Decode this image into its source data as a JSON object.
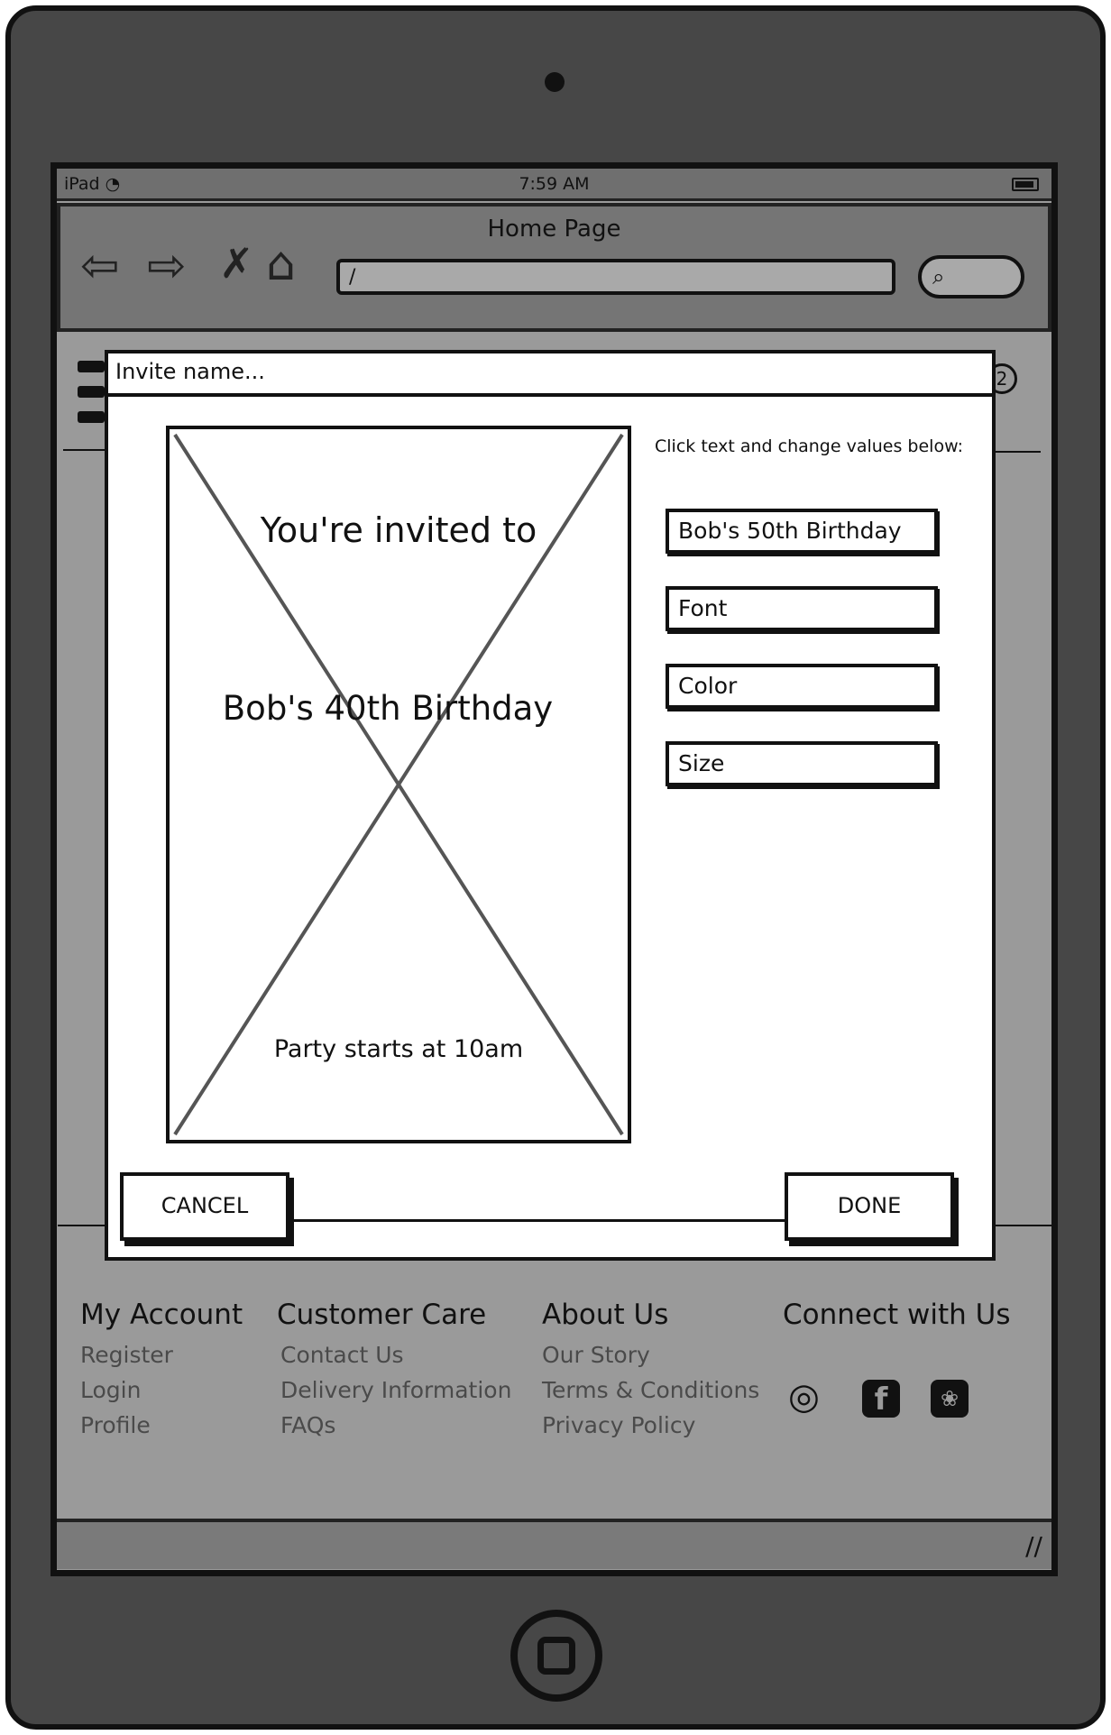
{
  "status_bar": {
    "device": "iPad",
    "time": "7:59 AM"
  },
  "browser": {
    "title": "Home Page",
    "url": "/",
    "icons": [
      "back-icon",
      "forward-icon",
      "close-icon",
      "home-icon",
      "search-icon"
    ]
  },
  "page": {
    "badge": "2"
  },
  "modal": {
    "title": "Invite name...",
    "instructions": "Click text and change values below:",
    "card": {
      "line1": "You're invited to",
      "line2": "Bob's 40th Birthday",
      "line3": "Party starts at 10am"
    },
    "fields": {
      "text": "Bob's 50th Birthday",
      "font": "Font",
      "color": "Color",
      "size": "Size"
    },
    "cancel_label": "CANCEL",
    "done_label": "DONE"
  },
  "footer": {
    "my_account": {
      "heading": "My Account",
      "links": [
        "Register",
        "Login",
        "Profile"
      ]
    },
    "customer_care": {
      "heading": "Customer Care",
      "links": [
        "Contact Us",
        "Delivery Information",
        "FAQs"
      ]
    },
    "about_us": {
      "heading": "About Us",
      "links": [
        "Our Story",
        "Terms & Conditions",
        "Privacy Policy"
      ]
    },
    "connect": {
      "heading": "Connect with Us",
      "icons": [
        "instagram-icon",
        "facebook-icon",
        "twitter-icon"
      ]
    }
  }
}
